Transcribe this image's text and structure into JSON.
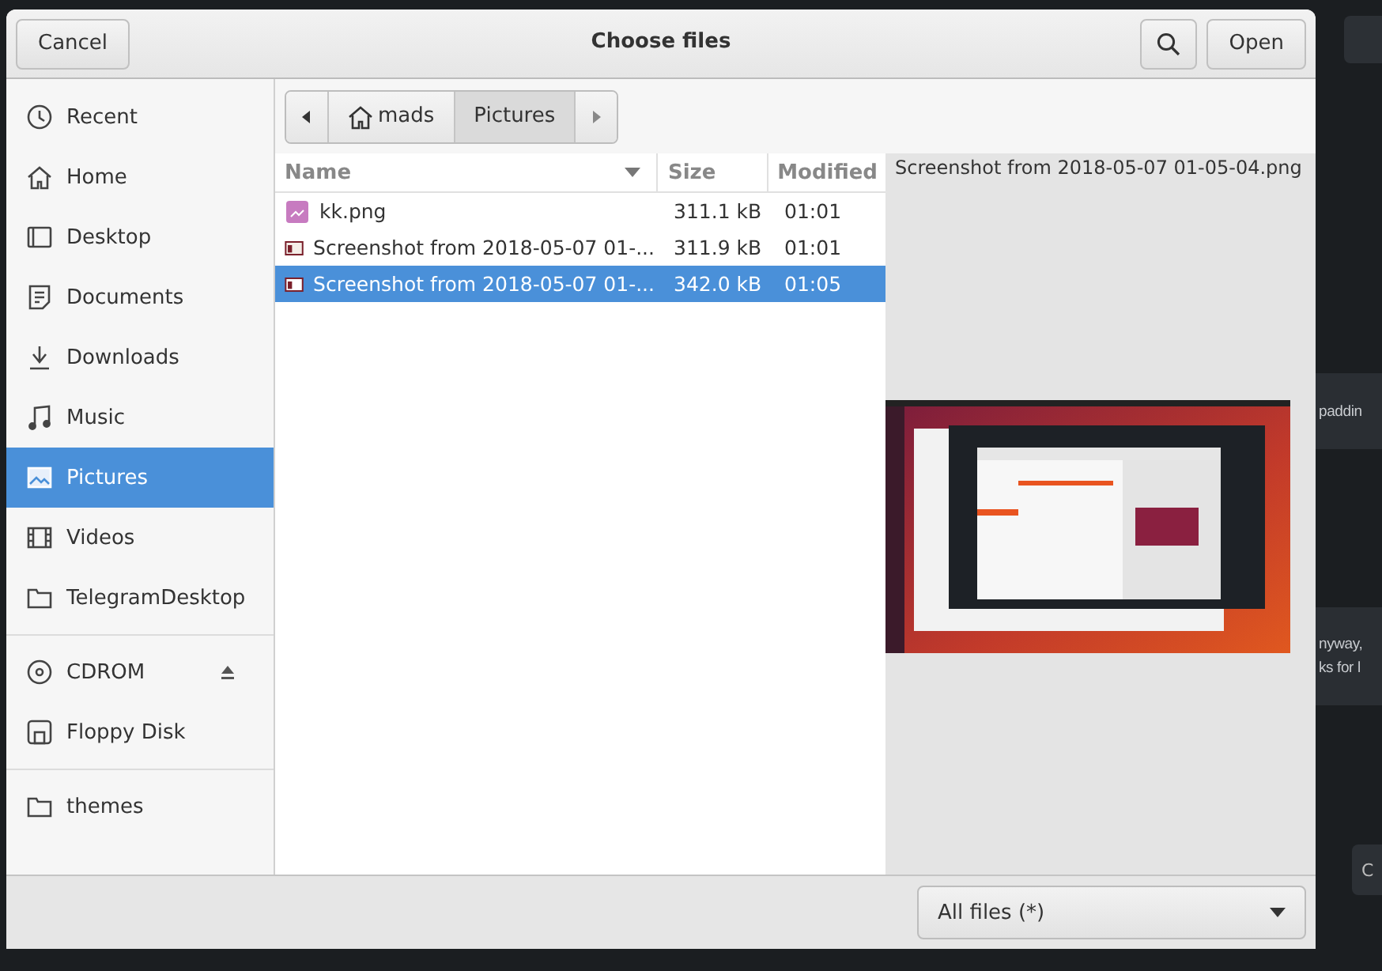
{
  "dialog": {
    "title": "Choose files",
    "cancel_button": "Cancel",
    "open_button": "Open"
  },
  "sidebar": {
    "groups": [
      [
        {
          "label": "Recent",
          "kind": "recent",
          "selected": false
        },
        {
          "label": "Home",
          "kind": "home",
          "selected": false
        },
        {
          "label": "Desktop",
          "kind": "desktop",
          "selected": false
        },
        {
          "label": "Documents",
          "kind": "document",
          "selected": false
        },
        {
          "label": "Downloads",
          "kind": "download",
          "selected": false
        },
        {
          "label": "Music",
          "kind": "music",
          "selected": false
        },
        {
          "label": "Pictures",
          "kind": "picture",
          "selected": true
        },
        {
          "label": "Videos",
          "kind": "video",
          "selected": false
        },
        {
          "label": "TelegramDesktop",
          "kind": "folder",
          "selected": false
        }
      ],
      [
        {
          "label": "CDROM",
          "kind": "disc",
          "selected": false,
          "eject": true
        },
        {
          "label": "Floppy Disk",
          "kind": "floppy",
          "selected": false
        }
      ],
      [
        {
          "label": "themes",
          "kind": "folder",
          "selected": false
        }
      ]
    ]
  },
  "path_bar": [
    {
      "label": "mads",
      "home": true,
      "selected": false
    },
    {
      "label": "Pictures",
      "home": false,
      "selected": true
    }
  ],
  "file_list": {
    "columns": [
      {
        "label": "Name",
        "sorted": true
      },
      {
        "label": "Size",
        "sorted": false
      },
      {
        "label": "Modified",
        "sorted": false
      }
    ],
    "rows": [
      {
        "name": "kk.png",
        "size": "311.1 kB",
        "modified": "01:01",
        "kind": "image",
        "selected": false
      },
      {
        "name": "Screenshot from 2018-05-07 01-...",
        "size": "311.9 kB",
        "modified": "01:01",
        "kind": "screenshot",
        "selected": false
      },
      {
        "name": "Screenshot from 2018-05-07 01-...",
        "size": "342.0 kB",
        "modified": "01:05",
        "kind": "screenshot",
        "selected": true
      }
    ]
  },
  "preview": {
    "filename": "Screenshot from 2018-05-07 01-05-04.png"
  },
  "filter": {
    "value": "All files (*)"
  },
  "background": {
    "texts": [
      {
        "kind": "single",
        "lines": [
          "paddin"
        ]
      },
      {
        "kind": "double",
        "lines": [
          "nyway,",
          "ks for l"
        ]
      }
    ],
    "button": "C"
  }
}
